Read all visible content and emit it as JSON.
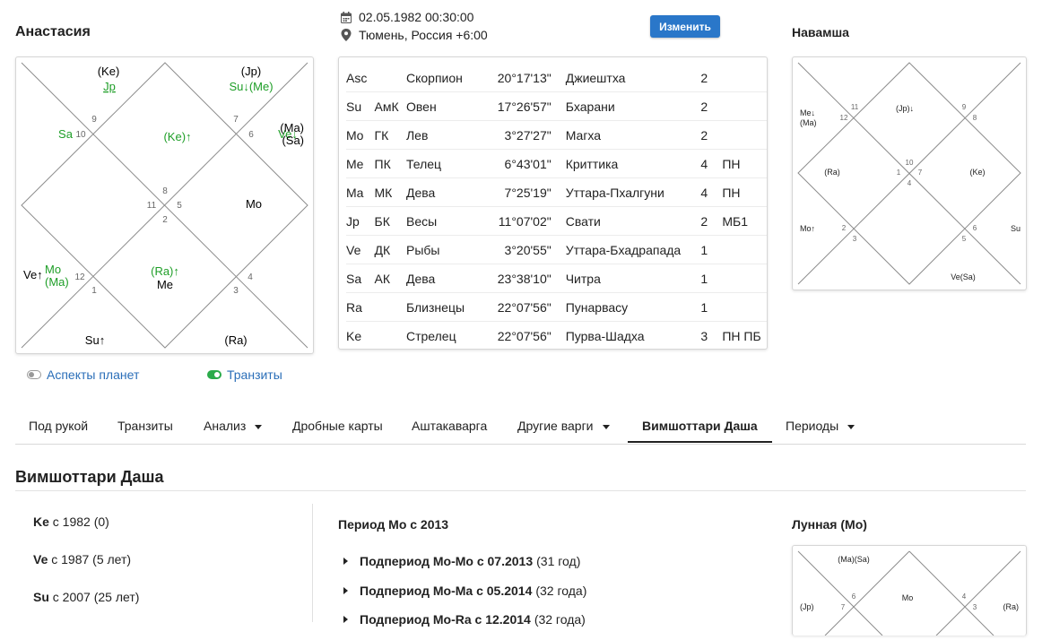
{
  "profile": {
    "name": "Анастасия",
    "datetime": "02.05.1982 00:30:00",
    "location": "Тюмень, Россия +6:00",
    "change_button": "Изменить"
  },
  "rasi_chart": {
    "labels": [
      {
        "text": "(Ke)",
        "color": "#000000"
      },
      {
        "text": "Jp",
        "color": "#1e9e27",
        "underline": true
      },
      {
        "text": "(Jp)",
        "color": "#000000"
      },
      {
        "text": "Su↓(Me)",
        "color": "#1e9e27"
      },
      {
        "text": "Sa",
        "color": "#1e9e27"
      },
      {
        "text": "(Ke)↑",
        "color": "#1e9e27"
      },
      {
        "text": "Ve↓",
        "color": "#1e9e27"
      },
      {
        "text": "(Ma)",
        "color": "#000000"
      },
      {
        "text": "(Sa)",
        "color": "#000000"
      },
      {
        "text": "Mo",
        "color": "#000000"
      },
      {
        "text": "Ve↑",
        "color": "#000000"
      },
      {
        "text": "Mo",
        "color": "#1e9e27"
      },
      {
        "text": "(Ma)",
        "color": "#1e9e27"
      },
      {
        "text": "(Ra)↑",
        "color": "#1e9e27"
      },
      {
        "text": "Me",
        "color": "#000000"
      },
      {
        "text": "Su↑",
        "color": "#000000"
      },
      {
        "text": "(Ra)",
        "color": "#000000"
      }
    ],
    "house_numbers": [
      "9",
      "10",
      "7",
      "6",
      "8",
      "11",
      "5",
      "2",
      "12",
      "1",
      "4",
      "3"
    ]
  },
  "planet_table": [
    [
      "Asc",
      "",
      "Скорпион",
      "20°17'13\"",
      "Джиештха",
      "2",
      ""
    ],
    [
      "Su",
      "АмК",
      "Овен",
      "17°26'57\"",
      "Бхарани",
      "2",
      ""
    ],
    [
      "Mo",
      "ГК",
      "Лев",
      "3°27'27\"",
      "Магха",
      "2",
      ""
    ],
    [
      "Me",
      "ПК",
      "Телец",
      "6°43'01\"",
      "Криттика",
      "4",
      "ПН"
    ],
    [
      "Ma",
      "МК",
      "Дева",
      "7°25'19\"",
      "Уттара-Пхалгуни",
      "4",
      "ПН"
    ],
    [
      "Jp",
      "БК",
      "Весы",
      "11°07'02\"",
      "Свати",
      "2",
      "МБ1"
    ],
    [
      "Ve",
      "ДК",
      "Рыбы",
      "3°20'55\"",
      "Уттара-Бхадрапада",
      "1",
      ""
    ],
    [
      "Sa",
      "АК",
      "Дева",
      "23°38'10\"",
      "Читра",
      "1",
      ""
    ],
    [
      "Ra",
      "",
      "Близнецы",
      "22°07'56\"",
      "Пунарвасу",
      "1",
      ""
    ],
    [
      "Ke",
      "",
      "Стрелец",
      "22°07'56\"",
      "Пурва-Шадха",
      "3",
      "ПН ПБ"
    ]
  ],
  "navamsha": {
    "title": "Навамша",
    "labels": [
      "Me↓",
      "(Ma)",
      "(Jp)↓",
      "(Ra)",
      "(Ke)",
      "Mo↑",
      "Su",
      "Ve(Sa)"
    ],
    "house_numbers": [
      "11",
      "12",
      "9",
      "8",
      "10",
      "1",
      "7",
      "4",
      "2",
      "3",
      "6",
      "5"
    ]
  },
  "toggles": {
    "aspects": {
      "label": "Аспекты планет",
      "on": false
    },
    "transits": {
      "label": "Транзиты",
      "on": true
    }
  },
  "tabs": [
    {
      "label": "Под рукой",
      "dropdown": false
    },
    {
      "label": "Транзиты",
      "dropdown": false
    },
    {
      "label": "Анализ",
      "dropdown": true
    },
    {
      "label": "Дробные карты",
      "dropdown": false
    },
    {
      "label": "Аштакаварга",
      "dropdown": false
    },
    {
      "label": "Другие варги",
      "dropdown": true
    },
    {
      "label": "Вимшоттари Даша",
      "dropdown": false,
      "active": true
    },
    {
      "label": "Периоды",
      "dropdown": true
    }
  ],
  "dasha": {
    "title": "Вимшоттари Даша",
    "periods": [
      {
        "planet": "Ke",
        "text": "с 1982 (0)"
      },
      {
        "planet": "Ve",
        "text": "с 1987 (5 лет)"
      },
      {
        "planet": "Su",
        "text": "с 2007 (25 лет)"
      }
    ],
    "current_title": "Период Mo с 2013",
    "subperiods": [
      {
        "bold": "Подпериод Mo-Mo с 07.2013",
        "rest": "(31 год)"
      },
      {
        "bold": "Подпериод Mo-Ma с 05.2014",
        "rest": "(32 года)"
      },
      {
        "bold": "Подпериод Mo-Ra с 12.2014",
        "rest": "(32 года)"
      }
    ]
  },
  "lunar": {
    "title": "Лунная (Mo)",
    "labels": [
      "(Ma)(Sa)",
      "Mo",
      "(Jp)",
      "(Ra)"
    ],
    "house_numbers": [
      "6",
      "7",
      "4",
      "3"
    ]
  },
  "colors": {
    "accent_blue": "#2a77c9",
    "link_blue": "#2a6eb8",
    "planet_green": "#1e9e27",
    "chart_line": "#8c8c8c"
  }
}
